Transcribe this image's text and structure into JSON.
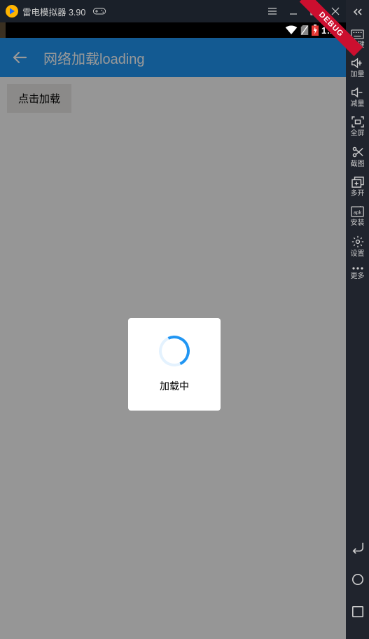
{
  "titlebar": {
    "title": "雷电模拟器 3.90"
  },
  "statusbar": {
    "time": "1:20",
    "debug_label": "DEBUG"
  },
  "appbar": {
    "title": "网络加载loading"
  },
  "body": {
    "load_button": "点击加载"
  },
  "dialog": {
    "text": "加载中"
  },
  "sidebar": {
    "items": [
      {
        "label": "按键"
      },
      {
        "label": "加量"
      },
      {
        "label": "减量"
      },
      {
        "label": "全屏"
      },
      {
        "label": "截图"
      },
      {
        "label": "多开"
      },
      {
        "label": "安装"
      },
      {
        "label": "设置"
      },
      {
        "label": "更多"
      }
    ]
  }
}
